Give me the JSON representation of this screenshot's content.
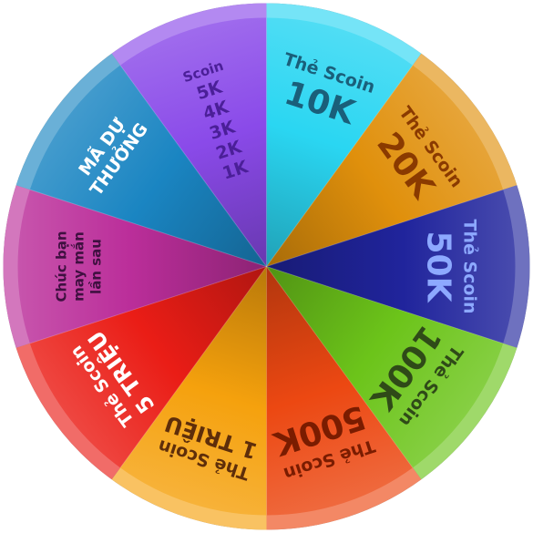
{
  "wheel": {
    "segments": [
      {
        "id": "the-scoin-10k",
        "color": "#2ad6f2",
        "text_color": "#1a5f7a",
        "lines": [
          {
            "text": "Thẻ Scoin",
            "size": "m"
          },
          {
            "text": "10K",
            "size": "xl"
          }
        ]
      },
      {
        "id": "the-scoin-20k",
        "color": "#e0900c",
        "text_color": "#8a3a00",
        "lines": [
          {
            "text": "Thẻ Scoin",
            "size": "m"
          },
          {
            "text": "20K",
            "size": "xl"
          }
        ]
      },
      {
        "id": "the-scoin-50k",
        "color": "#20249c",
        "text_color": "#8da9ff",
        "lines": [
          {
            "text": "Thẻ Scoin",
            "size": "m"
          },
          {
            "text": "50K",
            "size": "xl"
          }
        ]
      },
      {
        "id": "the-scoin-100k",
        "color": "#6cc41a",
        "text_color": "#2f4a18",
        "lines": [
          {
            "text": "Thẻ Scoin",
            "size": "m"
          },
          {
            "text": "100K",
            "size": "xl"
          }
        ]
      },
      {
        "id": "the-scoin-500k",
        "color": "#ec4812",
        "text_color": "#7a1c00",
        "lines": [
          {
            "text": "Thẻ Scoin",
            "size": "m"
          },
          {
            "text": "500K",
            "size": "xl"
          }
        ]
      },
      {
        "id": "the-scoin-1-trieu",
        "color": "#f5a10d",
        "text_color": "#5e2e0a",
        "lines": [
          {
            "text": "Thẻ Scoin",
            "size": "m"
          },
          {
            "text": "1 TRIỆU",
            "size": "l"
          }
        ]
      },
      {
        "id": "the-scoin-5-trieu",
        "color": "#ea1d16",
        "text_color": "#ffffff",
        "lines": [
          {
            "text": "Thẻ Scoin",
            "size": "m"
          },
          {
            "text": "5 TRIỆU",
            "size": "l"
          }
        ]
      },
      {
        "id": "chuc-ban-may-man",
        "color": "#bb2e9a",
        "text_color": "#3f1040",
        "lines": [
          {
            "text": "Chúc bạn",
            "size": "s"
          },
          {
            "text": "may mắn",
            "size": "s"
          },
          {
            "text": "lần sau",
            "size": "s"
          }
        ]
      },
      {
        "id": "ma-du-thuong",
        "color": "#1a85c2",
        "text_color": "#ffffff",
        "lines": [
          {
            "text": "MÃ DỰ",
            "size": "m"
          },
          {
            "text": "THƯỞNG",
            "size": "m"
          }
        ]
      },
      {
        "id": "scoin-list",
        "color": "#8a4ae9",
        "text_color": "#4b1f98",
        "lines": [
          {
            "text": "Scoin",
            "size": "s"
          },
          {
            "text": "5K",
            "size": "m"
          },
          {
            "text": "4K",
            "size": "m"
          },
          {
            "text": "3K",
            "size": "m"
          },
          {
            "text": "2K",
            "size": "m"
          },
          {
            "text": "1K",
            "size": "m"
          }
        ]
      }
    ],
    "rim_color": "#7f7f7f"
  }
}
